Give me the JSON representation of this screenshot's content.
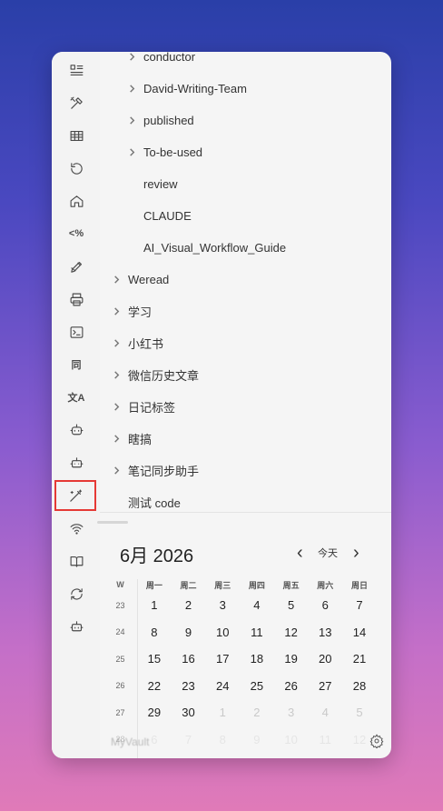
{
  "tree": {
    "items": [
      {
        "label": "conductor",
        "chevron": true,
        "indent": 1
      },
      {
        "label": "David-Writing-Team",
        "chevron": true,
        "indent": 1
      },
      {
        "label": "published",
        "chevron": true,
        "indent": 1
      },
      {
        "label": "To-be-used",
        "chevron": true,
        "indent": 1
      },
      {
        "label": "review",
        "chevron": false,
        "indent": 1
      },
      {
        "label": "CLAUDE",
        "chevron": false,
        "indent": 1
      },
      {
        "label": "AI_Visual_Workflow_Guide",
        "chevron": false,
        "indent": 1
      },
      {
        "label": "Weread",
        "chevron": true,
        "indent": 0
      },
      {
        "label": "学习",
        "chevron": true,
        "indent": 0
      },
      {
        "label": "小红书",
        "chevron": true,
        "indent": 0
      },
      {
        "label": "微信历史文章",
        "chevron": true,
        "indent": 0
      },
      {
        "label": "日记标签",
        "chevron": true,
        "indent": 0
      },
      {
        "label": "瞎搞",
        "chevron": true,
        "indent": 0
      },
      {
        "label": "笔记同步助手",
        "chevron": true,
        "indent": 0
      },
      {
        "label": "测试 code",
        "chevron": false,
        "indent": 0
      }
    ]
  },
  "ribbon": {
    "icons": [
      "list-icon",
      "tools-icon",
      "table-icon",
      "history-icon",
      "home-icon",
      "percent-code-icon",
      "pen-icon",
      "printer-icon",
      "terminal-icon",
      "tong-icon",
      "translate-icon",
      "bot-icon",
      "bot-alt-icon",
      "magic-wand-icon",
      "wifi-icon",
      "book-icon",
      "sync-icon",
      "bot-2-icon"
    ],
    "percent_text": "<%",
    "tong_text": "同",
    "translate_text": "文A",
    "highlight_color": "#e53935"
  },
  "calendar": {
    "title": "6月 2026",
    "today_label": "今天",
    "week_header": "W",
    "weekdays": [
      "周一",
      "周二",
      "周三",
      "周四",
      "周五",
      "周六",
      "周日"
    ],
    "weeks": [
      {
        "wk": "23",
        "days": [
          {
            "d": "1"
          },
          {
            "d": "2"
          },
          {
            "d": "3"
          },
          {
            "d": "4"
          },
          {
            "d": "5"
          },
          {
            "d": "6"
          },
          {
            "d": "7"
          }
        ]
      },
      {
        "wk": "24",
        "days": [
          {
            "d": "8"
          },
          {
            "d": "9"
          },
          {
            "d": "10"
          },
          {
            "d": "11"
          },
          {
            "d": "12"
          },
          {
            "d": "13"
          },
          {
            "d": "14"
          }
        ]
      },
      {
        "wk": "25",
        "days": [
          {
            "d": "15"
          },
          {
            "d": "16"
          },
          {
            "d": "17"
          },
          {
            "d": "18"
          },
          {
            "d": "19"
          },
          {
            "d": "20"
          },
          {
            "d": "21"
          }
        ]
      },
      {
        "wk": "26",
        "days": [
          {
            "d": "22"
          },
          {
            "d": "23"
          },
          {
            "d": "24"
          },
          {
            "d": "25"
          },
          {
            "d": "26"
          },
          {
            "d": "27"
          },
          {
            "d": "28"
          }
        ]
      },
      {
        "wk": "27",
        "days": [
          {
            "d": "29"
          },
          {
            "d": "30"
          },
          {
            "d": "1",
            "m": true
          },
          {
            "d": "2",
            "m": true
          },
          {
            "d": "3",
            "m": true
          },
          {
            "d": "4",
            "m": true
          },
          {
            "d": "5",
            "m": true
          }
        ]
      },
      {
        "wk": "28",
        "days": [
          {
            "d": "6",
            "m": true
          },
          {
            "d": "7",
            "m": true
          },
          {
            "d": "8",
            "m": true
          },
          {
            "d": "9",
            "m": true
          },
          {
            "d": "10",
            "m": true
          },
          {
            "d": "11",
            "m": true
          },
          {
            "d": "12",
            "m": true
          }
        ]
      }
    ]
  },
  "footer": {
    "vault_name": "MyVault"
  }
}
